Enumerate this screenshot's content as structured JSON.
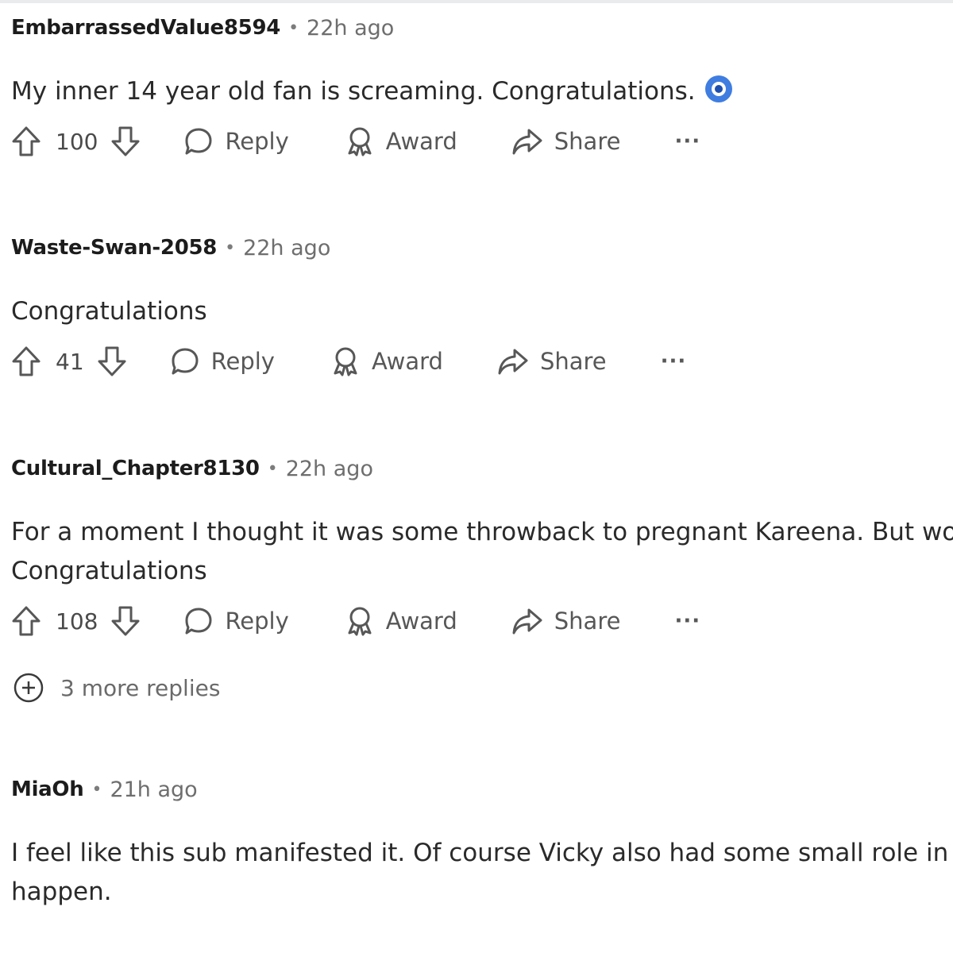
{
  "comments": [
    {
      "author": "EmbarrassedValue8594",
      "time": "22h ago",
      "body": [
        "My inner 14 year old fan is screaming. Congratulations."
      ],
      "emoji": "nazar-amulet-emoji",
      "votes": "100"
    },
    {
      "author": "Waste-Swan-2058",
      "time": "22h ago",
      "body": [
        "Congratulations"
      ],
      "votes": "41"
    },
    {
      "author": "Cultural_Chapter8130",
      "time": "22h ago",
      "body": [
        "For a moment I thought it was some throwback to pregnant Kareena. But woho",
        "Congratulations"
      ],
      "votes": "108",
      "more_replies": "3 more replies"
    },
    {
      "author": "MiaOh",
      "time": "21h ago",
      "body": [
        "I feel like this sub manifested it. Of course Vicky also had some small role in ma",
        "happen."
      ]
    }
  ],
  "actions": {
    "reply": "Reply",
    "award": "Award",
    "share": "Share",
    "more": "···"
  },
  "separator": "•",
  "icons": {
    "upvote": "upvote-arrow-icon",
    "downvote": "downvote-arrow-icon",
    "reply": "speech-bubble-icon",
    "award": "award-ribbon-icon",
    "share": "share-arrow-icon",
    "expand": "plus-circle-icon"
  }
}
